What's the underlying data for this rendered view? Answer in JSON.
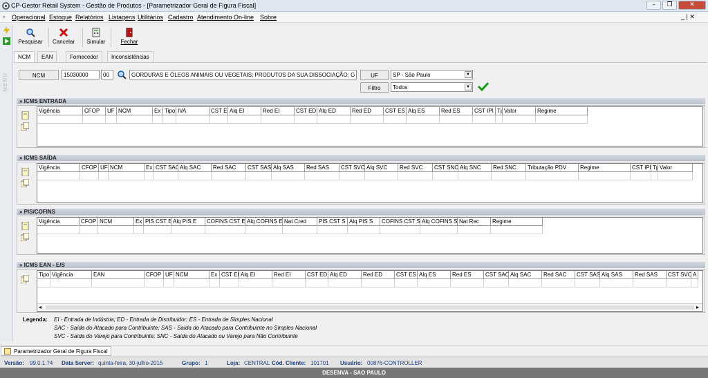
{
  "window": {
    "title": "CP-Gestor Retail System - Gestão de Produtos - [Parametrizador Geral de Figura Fiscal]"
  },
  "menu": [
    "Operacional",
    "Estoque",
    "Relatórios",
    "Listagens",
    "Utilitários",
    "Cadastro",
    "Atendimento On-line",
    "Sobre"
  ],
  "sidebar": {
    "label": "MENU"
  },
  "toolbar": {
    "pesquisar": "Pesquisar",
    "cancelar": "Cancelar",
    "simular": "Simular",
    "fechar": "Fechar"
  },
  "tabs": [
    "NCM",
    "EAN",
    "Fornecedor",
    "Inconsistências"
  ],
  "filters": {
    "ncm_label": "NCM",
    "ncm_value": "15030000",
    "ncm_ex": "00",
    "ncm_desc": "GORDURAS E ÓLEOS ANIMAIS OU VEGETAIS; PRODUTOS DA SUA DISSOCIAÇÃO; G",
    "uf_label": "UF",
    "uf_value": "SP - São Paulo",
    "filtro_label": "Filtro",
    "filtro_value": "Todos"
  },
  "sections": {
    "icms_entrada": {
      "title": "» ICMS ENTRADA",
      "columns": [
        "Vigência",
        "CFOP",
        "UF",
        "NCM",
        "Ex",
        "Tipo",
        "IVA",
        "CST EI",
        "Alq EI",
        "Red EI",
        "CST ED",
        "Alq ED",
        "Red ED",
        "CST ES",
        "Alq ES",
        "Red ES",
        "CST IPI",
        "Tp",
        "Valor",
        "Regime"
      ]
    },
    "icms_saida": {
      "title": "» ICMS SAÍDA",
      "columns": [
        "Vigência",
        "CFOP",
        "UF",
        "NCM",
        "Ex",
        "CST SAC",
        "Alq SAC",
        "Red SAC",
        "CST SAS",
        "Alq SAS",
        "Red SAS",
        "CST SVC",
        "Alq SVC",
        "Red SVC",
        "CST SNC",
        "Alq SNC",
        "Red SNC",
        "Tributação PDV",
        "Regime",
        "CST IPI",
        "Tp",
        "Valor"
      ]
    },
    "pis_cofins": {
      "title": "» PIS/COFINS",
      "columns": [
        "Vigência",
        "CFOP",
        "NCM",
        "Ex",
        "PIS CST E",
        "Alq PIS E",
        "COFINS CST E",
        "Alq COFINS E",
        "Nat Cred",
        "PIS CST S",
        "Alq PIS S",
        "COFINS CST S",
        "Alq COFINS S",
        "Nat Rec",
        "Regime"
      ]
    },
    "icms_ean": {
      "title": "» ICMS EAN - E/S",
      "columns": [
        "Tipo",
        "Vigência",
        "EAN",
        "CFOP",
        "UF",
        "NCM",
        "Ex",
        "CST EI",
        "Alq EI",
        "Red EI",
        "CST ED",
        "Alq ED",
        "Red ED",
        "CST ES",
        "Alq ES",
        "Red ES",
        "CST SAC",
        "Alq SAC",
        "Red SAC",
        "CST SAS",
        "Alq SAS",
        "Red SAS",
        "CST SVC",
        "A"
      ]
    }
  },
  "legend": {
    "label": "Legenda:",
    "line1": "EI - Entrada de Indústria;  ED - Entrada de Distribuidor;  ES - Entrada de Simples Nacional",
    "line2": "SAC - Saída do Atacado para Contribuinte;  SAS - Saída do Atacado para Contribuinte no Simples Nacional",
    "line3": "SVC - Saída do Varejo para Contribuinte;  SNC - Saída do Atacado ou Varejo para Não Contribuinte"
  },
  "taskbar": {
    "tab": "Parametrizador Geral de Figura Fiscal"
  },
  "status": {
    "versao_label": "Versão:",
    "versao": "99.0.1.74",
    "server_label": "Data Server:",
    "server": "quinta-feira, 30-julho-2015",
    "grupo_label": "Grupo:",
    "grupo": "1",
    "loja_label": "Loja:",
    "loja": "CENTRAL",
    "cliente_label": "Cód. Cliente:",
    "cliente": "101701",
    "usuario_label": "Usuário:",
    "usuario": "00876-CONTROLLER"
  },
  "footer": "DESENVA - SAO PAULO",
  "colors": {
    "accent": "#1e5bb5",
    "confirm": "#1a9a1a",
    "close": "#c74b3b"
  }
}
